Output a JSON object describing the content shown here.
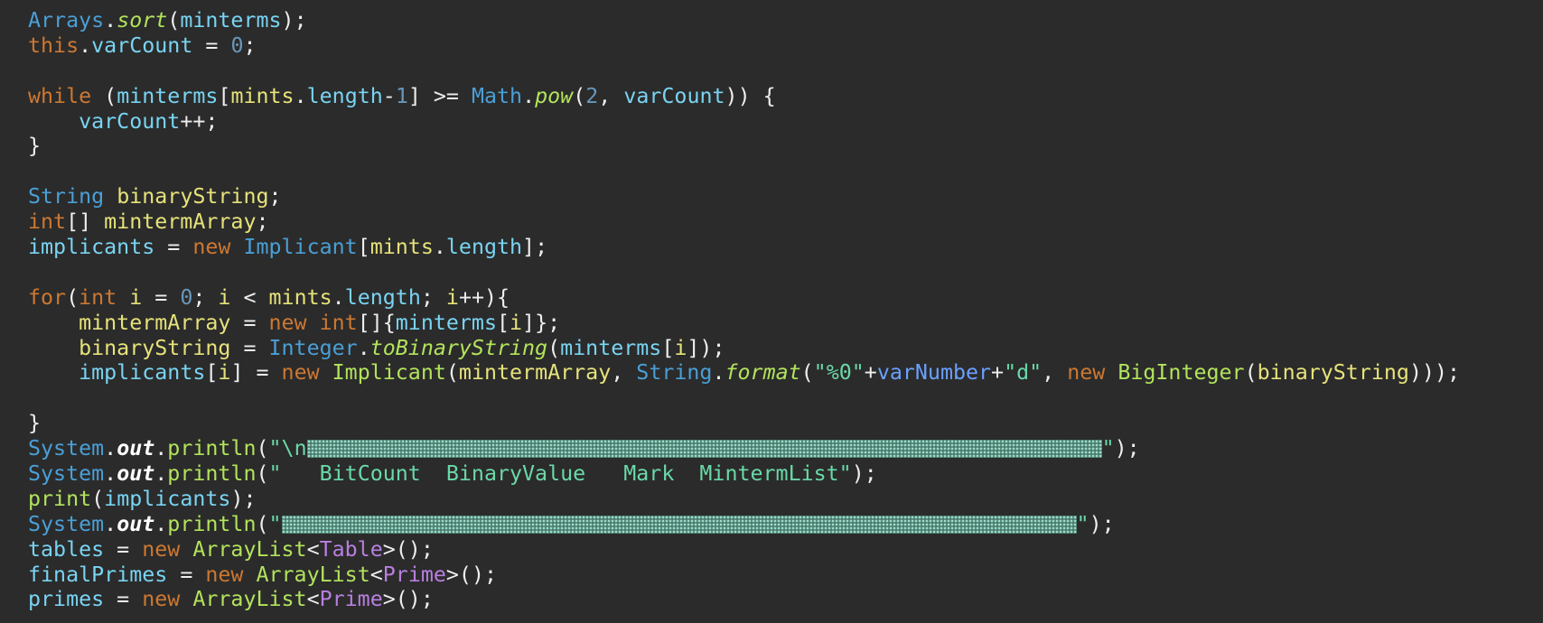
{
  "colors": {
    "background": "#2b2b2b",
    "keyword": "#cc7832",
    "type": "#4a9fd6",
    "field": "#79d4f2",
    "local": "#e6e27a",
    "method": "#b2e35c",
    "number": "#6897bb",
    "string": "#6ad8a8",
    "generic": "#b97fe0"
  },
  "code": {
    "l1": {
      "a": "Arrays",
      "b": ".",
      "c": "sort",
      "d": "(",
      "e": "minterms",
      "f": ");"
    },
    "l2": {
      "a": "this",
      "b": ".",
      "c": "varCount",
      "d": " = ",
      "e": "0",
      "f": ";"
    },
    "l4": {
      "a": "while",
      "b": " (",
      "c": "minterms",
      "d": "[",
      "e": "mints",
      "f": ".",
      "g": "length",
      "h": "-",
      "i": "1",
      "j": "] >= ",
      "k": "Math",
      "l": ".",
      "m": "pow",
      "n": "(",
      "o": "2",
      "p": ", ",
      "q": "varCount",
      "r": ")) {"
    },
    "l5": {
      "a": "    ",
      "b": "varCount",
      "c": "++;"
    },
    "l6": {
      "a": "}"
    },
    "l8": {
      "a": "String",
      "b": " ",
      "c": "binaryString",
      "d": ";"
    },
    "l9": {
      "a": "int",
      "b": "[] ",
      "c": "mintermArray",
      "d": ";"
    },
    "l10": {
      "a": "implicants",
      "b": " = ",
      "c": "new",
      "d": " ",
      "e": "Implicant",
      "f": "[",
      "g": "mints",
      "h": ".",
      "i": "length",
      "j": "];"
    },
    "l12": {
      "a": "for",
      "b": "(",
      "c": "int",
      "d": " ",
      "e": "i",
      "f": " = ",
      "g": "0",
      "h": "; ",
      "i": "i",
      "j": " < ",
      "k": "mints",
      "l": ".",
      "m": "length",
      "n": "; ",
      "o": "i",
      "p": "++){"
    },
    "l13": {
      "a": "    ",
      "b": "mintermArray",
      "c": " = ",
      "d": "new",
      "e": " ",
      "f": "int",
      "g": "[]{",
      "h": "minterms",
      "i": "[",
      "j": "i",
      "k": "]};"
    },
    "l14": {
      "a": "    ",
      "b": "binaryString",
      "c": " = ",
      "d": "Integer",
      "e": ".",
      "f": "toBinaryString",
      "g": "(",
      "h": "minterms",
      "i": "[",
      "j": "i",
      "k": "]);"
    },
    "l15": {
      "a": "    ",
      "b": "implicants",
      "c": "[",
      "d": "i",
      "e": "] = ",
      "f": "new",
      "g": " ",
      "h": "Implicant",
      "i": "(",
      "j": "mintermArray",
      "k": ", ",
      "l": "String",
      "m": ".",
      "n": "format",
      "o": "(",
      "p": "\"%0\"",
      "q": "+",
      "r": "varNumber",
      "s": "+",
      "t": "\"d\"",
      "u": ", ",
      "v": "new",
      "w": " ",
      "x": "BigInteger",
      "y": "(",
      "z": "binaryString",
      "zz": ")));"
    },
    "l17": {
      "a": "}"
    },
    "l18": {
      "a": "System",
      "b": ".",
      "c": "out",
      "d": ".",
      "e": "println",
      "f": "(",
      "g": "\"\\n",
      "h": "\"",
      "i": ");"
    },
    "l19": {
      "a": "System",
      "b": ".",
      "c": "out",
      "d": ".",
      "e": "println",
      "f": "(",
      "g": "\"   BitCount  BinaryValue   Mark  MintermList\"",
      "h": ");"
    },
    "l20": {
      "a": "print",
      "b": "(",
      "c": "implicants",
      "d": ");"
    },
    "l21": {
      "a": "System",
      "b": ".",
      "c": "out",
      "d": ".",
      "e": "println",
      "f": "(",
      "g": "\"",
      "h": "\"",
      "i": ");"
    },
    "l22": {
      "a": "tables",
      "b": " = ",
      "c": "new",
      "d": " ",
      "e": "ArrayList",
      "f": "<",
      "g": "Table",
      "h": ">();"
    },
    "l23": {
      "a": "finalPrimes",
      "b": " = ",
      "c": "new",
      "d": " ",
      "e": "ArrayList",
      "f": "<",
      "g": "Prime",
      "h": ">();"
    },
    "l24": {
      "a": "primes",
      "b": " = ",
      "c": "new",
      "d": " ",
      "e": "ArrayList",
      "f": "<",
      "g": "Prime",
      "h": ">();"
    }
  }
}
